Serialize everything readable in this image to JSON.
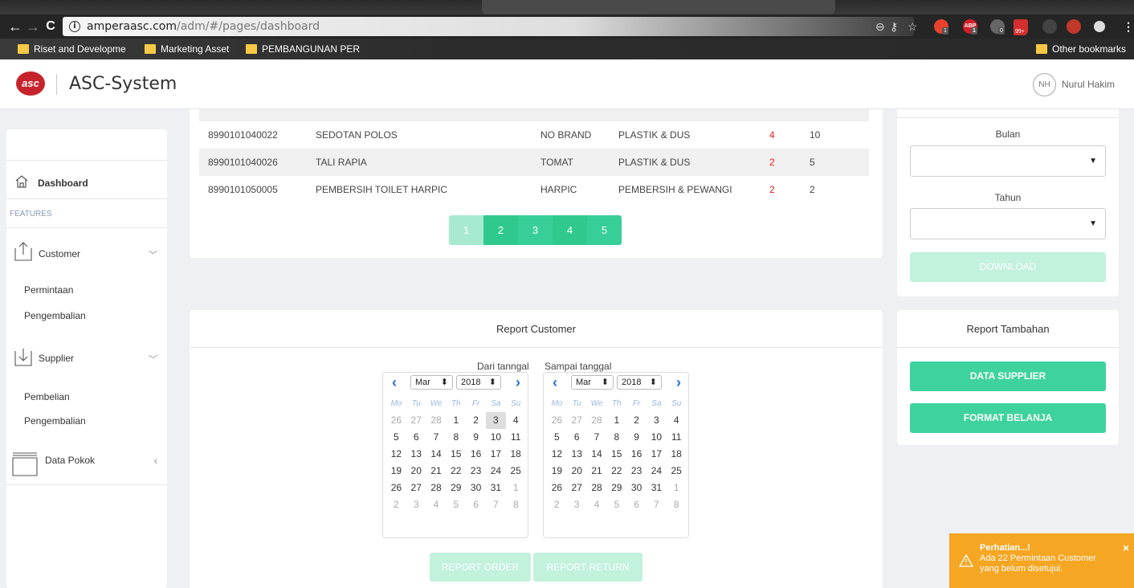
{
  "browser": {
    "url_host": "amperaasc.com",
    "url_path": "/adm/#/pages/dashboard",
    "bookmarks": [
      "Riset and Developme",
      "Marketing Asset",
      "PEMBANGUNAN PER"
    ],
    "other_bookmarks": "Other bookmarks",
    "ext_badges": [
      "1",
      "1",
      "0",
      "99+"
    ]
  },
  "header": {
    "logo_text": "asc",
    "title": "ASC-System",
    "user_initials": "NH",
    "user_name": "Nurul Hakim"
  },
  "sidebar": {
    "dashboard": "Dashboard",
    "features_label": "FEATURES",
    "customer": "Customer",
    "customer_items": [
      "Permintaan",
      "Pengembalian"
    ],
    "supplier": "Supplier",
    "supplier_items": [
      "Pembelian",
      "Pengembalian"
    ],
    "data_pokok": "Data Pokok"
  },
  "stock_table": {
    "rows": [
      {
        "code": "8990101040022",
        "name": "SEDOTAN POLOS",
        "brand": "NO BRAND",
        "category": "PLASTIK & DUS",
        "qty": "4",
        "min": "10"
      },
      {
        "code": "8990101040026",
        "name": "TALI RAPIA",
        "brand": "TOMAT",
        "category": "PLASTIK & DUS",
        "qty": "2",
        "min": "5"
      },
      {
        "code": "8990101050005",
        "name": "PEMBERSIH TOILET HARPIC",
        "brand": "HARPIC",
        "category": "PEMBERSIH & PEWANGI",
        "qty": "2",
        "min": "2"
      }
    ],
    "pages": [
      "1",
      "2",
      "3",
      "4",
      "5"
    ],
    "current_page": "1"
  },
  "export_panel": {
    "bulan_label": "Bulan",
    "tahun_label": "Tahun",
    "bulan_value": "",
    "tahun_value": "",
    "download": "DOWNLOAD"
  },
  "report_customer": {
    "title": "Report Customer",
    "from_label": "Dari tanngal",
    "to_label": "Sampai tanggal",
    "month": "Mar",
    "year": "2018",
    "weekdays": [
      "Mo",
      "Tu",
      "We",
      "Th",
      "Fr",
      "Sa",
      "Su"
    ],
    "weeks": [
      [
        "26",
        "27",
        "28",
        "1",
        "2",
        "3",
        "4"
      ],
      [
        "5",
        "6",
        "7",
        "8",
        "9",
        "10",
        "11"
      ],
      [
        "12",
        "13",
        "14",
        "15",
        "16",
        "17",
        "18"
      ],
      [
        "19",
        "20",
        "21",
        "22",
        "23",
        "24",
        "25"
      ],
      [
        "26",
        "27",
        "28",
        "29",
        "30",
        "31",
        "1"
      ],
      [
        "2",
        "3",
        "4",
        "5",
        "6",
        "7",
        "8"
      ]
    ],
    "today": "3",
    "report_order": "REPORT ORDER",
    "report_return": "REPORT RETURN"
  },
  "report_tambahan": {
    "title": "Report Tambahan",
    "data_supplier": "DATA SUPPLIER",
    "format_belanja": "FORMAT BELANJA"
  },
  "toast": {
    "title": "Perhatian...!",
    "message_line1": "Ada 22 Permintaan Customer",
    "message_line2": "yang belum disetujui.",
    "close": "×"
  },
  "colors": {
    "accent_green": "#3ed39c",
    "accent_green_dim": "#c2f1dc",
    "warning_orange": "#f5a623",
    "danger_red": "#e02020",
    "logo_red": "#c6232d"
  }
}
